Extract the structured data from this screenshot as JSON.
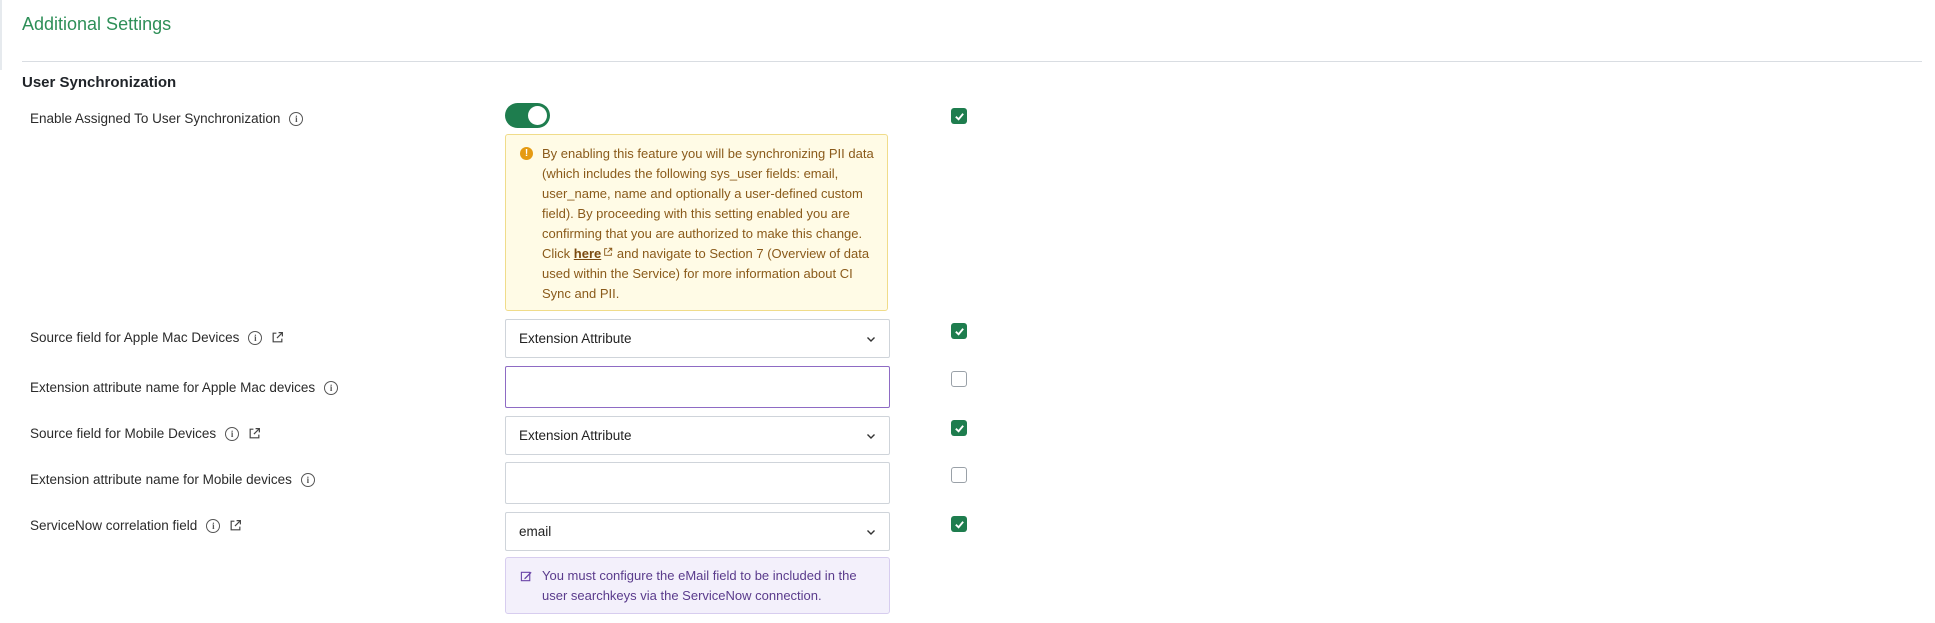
{
  "page": {
    "title": "Additional Settings"
  },
  "section": {
    "title": "User Synchronization"
  },
  "rows": {
    "enable_sync": {
      "label": "Enable Assigned To User Synchronization",
      "toggle_on": true,
      "checked": true
    },
    "warning": {
      "text_before": "By enabling this feature you will be synchronizing PII data (which includes the following sys_user fields: email, user_name, name and optionally a user-defined custom field). By proceeding with this setting enabled you are confirming that you are authorized to make this change. Click ",
      "link_text": "here",
      "text_after": " and navigate to Section 7 (Overview of data used within the Service) for more information about CI Sync and PII."
    },
    "source_mac": {
      "label": "Source field for Apple Mac Devices",
      "value": "Extension Attribute",
      "checked": true
    },
    "ext_attr_mac": {
      "label": "Extension attribute name for Apple Mac devices",
      "value": "",
      "checked": false
    },
    "source_mobile": {
      "label": "Source field for Mobile Devices",
      "value": "Extension Attribute",
      "checked": true
    },
    "ext_attr_mobile": {
      "label": "Extension attribute name for Mobile devices",
      "value": "",
      "checked": false
    },
    "correlation": {
      "label": "ServiceNow correlation field",
      "value": "email",
      "checked": true
    },
    "note": {
      "text": "You must configure the eMail field to be included in the user searchkeys via the ServiceNow connection."
    }
  },
  "colors": {
    "accent_green": "#1e7d4e",
    "title_green": "#2e8f58",
    "warning_bg": "#fffbe6",
    "note_bg": "#f3f0fb"
  }
}
